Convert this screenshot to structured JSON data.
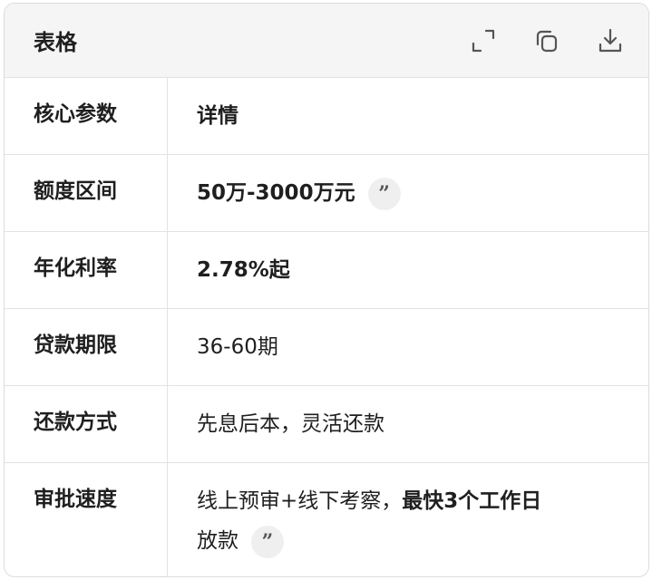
{
  "card": {
    "title": "表格",
    "actions": [
      {
        "icon": "expand-icon"
      },
      {
        "icon": "copy-icon"
      },
      {
        "icon": "download-icon"
      }
    ]
  },
  "table": {
    "headers": [
      "核心参数",
      "详情"
    ],
    "rows": [
      {
        "key": "额度区间",
        "value_bold": "50万-3000万元",
        "value_plain": "",
        "has_citation": true
      },
      {
        "key": "年化利率",
        "value_bold": "2.78%起",
        "value_plain": "",
        "has_citation": false
      },
      {
        "key": "贷款期限",
        "value_bold": "",
        "value_plain": "36-60期",
        "has_citation": false
      },
      {
        "key": "还款方式",
        "value_bold": "",
        "value_plain": "先息后本，灵活还款",
        "has_citation": false
      },
      {
        "key": "审批速度",
        "value_plain": "线上预审+线下考察，",
        "value_bold": "最快3个工作日",
        "value_tail": "放款",
        "has_citation": true
      }
    ],
    "citation_glyph": "”"
  }
}
